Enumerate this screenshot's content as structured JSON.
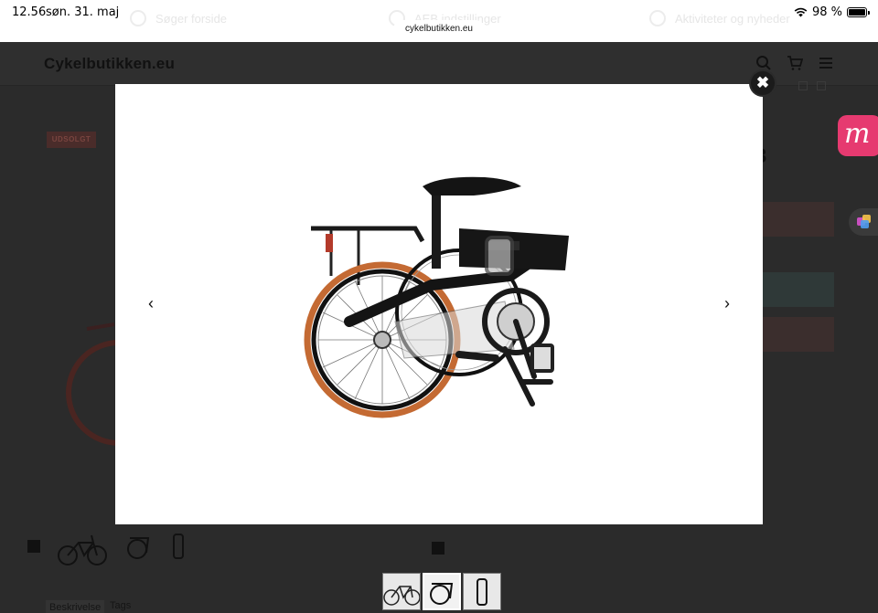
{
  "status_bar": {
    "time": "12.56",
    "date": "søn. 31. maj",
    "battery": "98 %",
    "battery_level": 0.98
  },
  "browser": {
    "url": "cykelbutikken.eu",
    "toolbar": {
      "search_label": "Søger forside",
      "settings_label": "AEB indstillinger",
      "news_label": "Aktiviteter og nyheder"
    }
  },
  "site": {
    "logo": "Cykelbutikken.eu",
    "soldout_badge": "UDSOLGT",
    "price_fragment": "3",
    "tabs": [
      "Beskrivelse",
      "Tags"
    ]
  },
  "widgets": {
    "m_badge": "m"
  },
  "icons": {
    "header": [
      "search-icon",
      "cart-icon",
      "menu-icon"
    ],
    "lightbox": [
      "close-icon",
      "chevron-left-icon",
      "chevron-right-icon"
    ]
  },
  "lightbox": {
    "prev_label": "‹",
    "next_label": "›",
    "close_label": "✖",
    "thumbnail_count": 3,
    "active_thumbnail": 2
  }
}
